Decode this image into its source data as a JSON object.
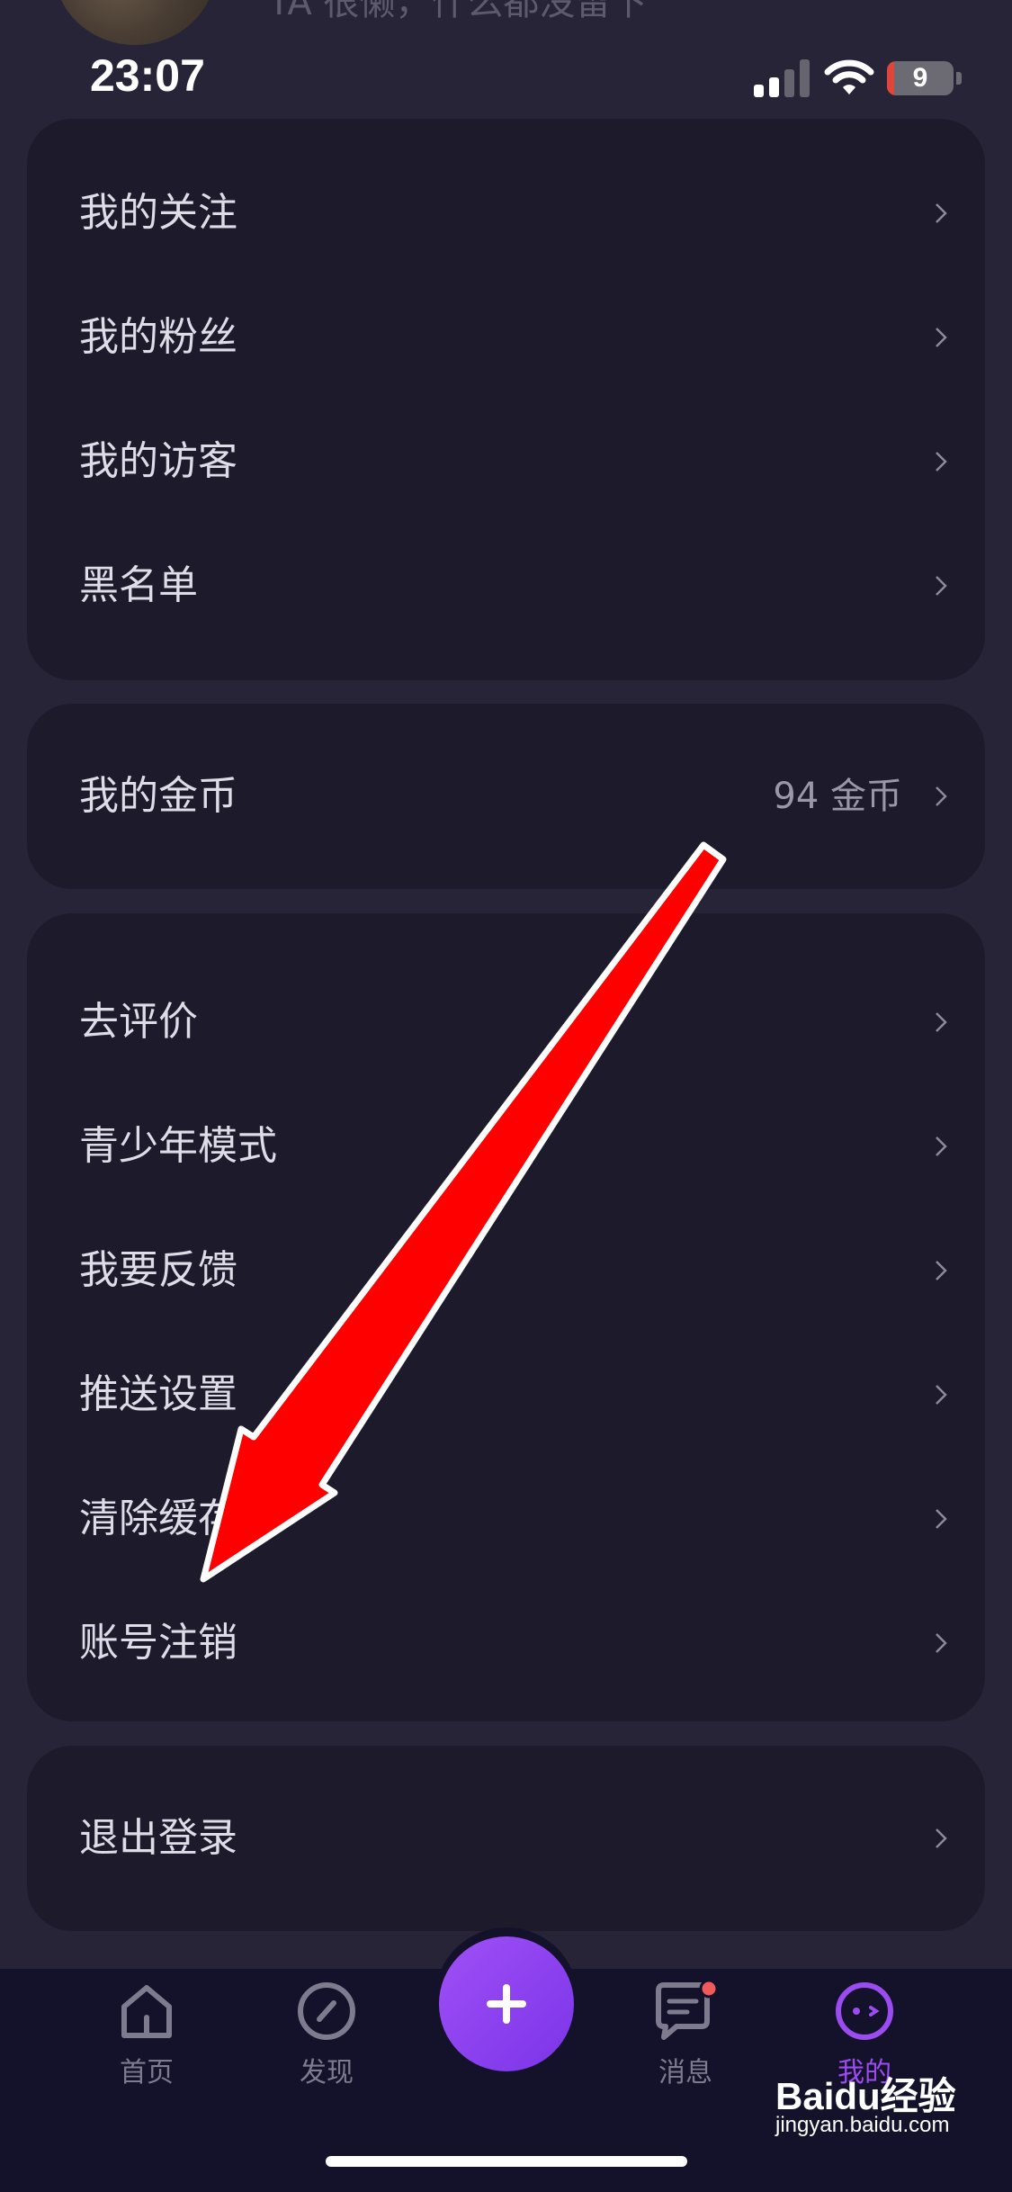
{
  "profile": {
    "bio_text": "TA 很懒，什么都没留下"
  },
  "status_bar": {
    "time": "23:07",
    "battery": "9"
  },
  "social_card": [
    {
      "label": "我的关注"
    },
    {
      "label": "我的粉丝"
    },
    {
      "label": "我的访客"
    },
    {
      "label": "黑名单"
    }
  ],
  "coins_card": {
    "label": "我的金币",
    "value": "94 金币"
  },
  "settings_card": [
    {
      "label": "去评价"
    },
    {
      "label": "青少年模式"
    },
    {
      "label": "我要反馈"
    },
    {
      "label": "推送设置"
    },
    {
      "label": "清除缓存"
    },
    {
      "label": "账号注销"
    }
  ],
  "logout_card": {
    "label": "退出登录"
  },
  "tabbar": {
    "home": "首页",
    "discover": "发现",
    "messages": "消息",
    "mine": "我的"
  },
  "watermark": {
    "brand": "Baidu经验",
    "url": "jingyan.baidu.com"
  },
  "colors": {
    "accent": "#9a4cf0",
    "arrow": "#ff0000",
    "background": "#282438",
    "card": "#1c1a2b"
  }
}
